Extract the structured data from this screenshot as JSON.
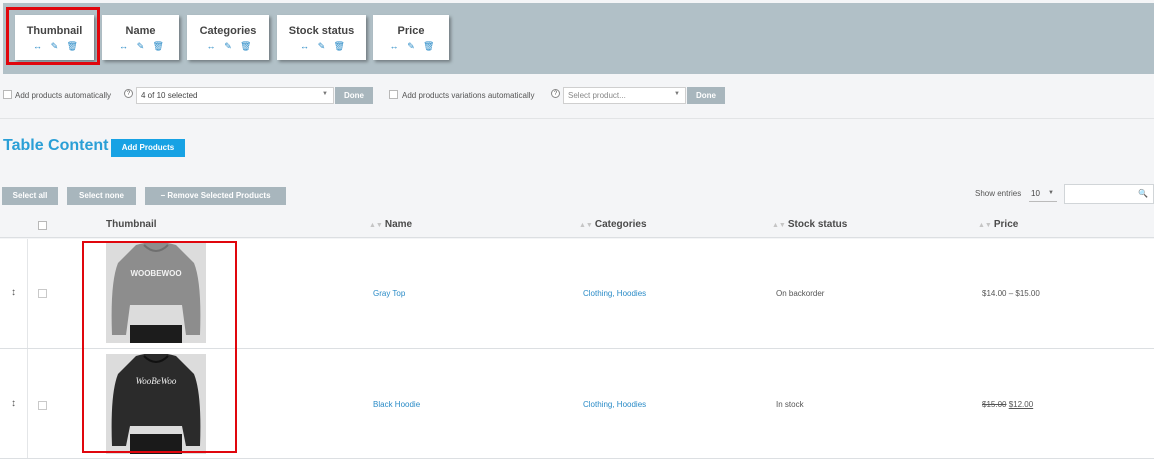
{
  "columns": [
    {
      "label": "Thumbnail"
    },
    {
      "label": "Name"
    },
    {
      "label": "Categories"
    },
    {
      "label": "Stock status"
    },
    {
      "label": "Price"
    }
  ],
  "options": {
    "add_products_auto": "Add products automatically",
    "products_selected": "4 of 10 selected",
    "done": "Done",
    "add_variations_auto": "Add products variations automatically",
    "select_product_placeholder": "Select product...",
    "help_glyph": "?"
  },
  "table_content": {
    "title": "Table Content",
    "add_products": "Add Products",
    "select_all": "Select all",
    "select_none": "Select none",
    "remove_selected": "− Remove Selected Products",
    "show_entries_label": "Show entries",
    "entries_value": "10"
  },
  "table": {
    "headers": [
      "Thumbnail",
      "Name",
      "Categories",
      "Stock status",
      "Price"
    ],
    "rows": [
      {
        "name": "Gray Top",
        "categories": "Clothing, Hoodies",
        "stock": "On backorder",
        "price": "$14.00 – $15.00",
        "thumb_text": "WOOBEWOO",
        "hoodie_color": "#8d8d8d"
      },
      {
        "name": "Black Hoodie",
        "categories": "Clothing, Hoodies",
        "stock": "In stock",
        "price_old": "$15.00",
        "price_new": "$12.00",
        "thumb_text": "WooBeWoo",
        "hoodie_color": "#2b2b2b"
      }
    ]
  },
  "colors": {
    "accent": "#17a2e4",
    "link": "#2a8bc7",
    "highlight": "#e0060d",
    "toolbar_bg": "#b1c0c7"
  }
}
